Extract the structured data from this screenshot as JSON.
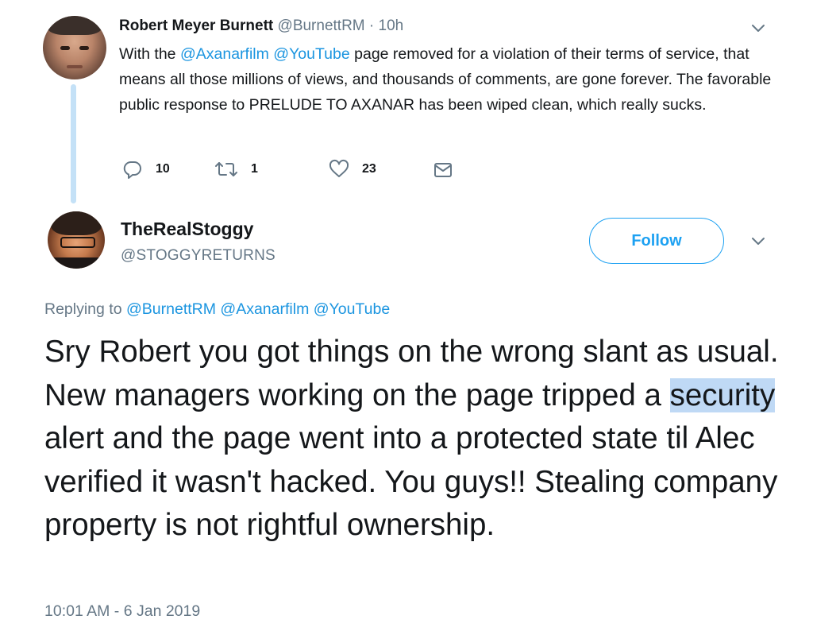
{
  "parent_tweet": {
    "author_name": "Robert Meyer Burnett",
    "author_handle": "@BurnettRM",
    "separator": "·",
    "time": "10h",
    "text_part1": "With the ",
    "mention1": "@Axanarfilm",
    "text_part2": " ",
    "mention2": "@YouTube",
    "text_part3": " page removed for a violation of their terms of service, that means all those millions of views, and thousands of comments, are gone forever. The favorable public response to PRELUDE TO AXANAR has been wiped clean, which really sucks.",
    "reply_count": "10",
    "retweet_count": "1",
    "like_count": "23"
  },
  "reply_tweet": {
    "author_name": "TheRealStoggy",
    "author_handle": "@STOGGYRETURNS",
    "follow_label": "Follow",
    "replying_prefix": "Replying to ",
    "replying_to": [
      "@BurnettRM",
      "@Axanarfilm",
      "@YouTube"
    ],
    "text_before": "Sry Robert you got things on the wrong slant as usual. New managers working on the page tripped a ",
    "text_highlight": "security",
    "text_after": " alert and the page went into a protected state til Alec verified it wasn't hacked.  You guys!! Stealing company property is not rightful ownership.",
    "timestamp": "10:01 AM - 6 Jan 2019"
  },
  "icons": {
    "reply": "reply-icon",
    "retweet": "retweet-icon",
    "like": "heart-icon",
    "dm": "envelope-icon",
    "menu": "chevron-down-icon"
  },
  "colors": {
    "link": "#1b95e0",
    "secondary_text": "#657786",
    "thread_line": "#c4e1f7",
    "selection_highlight": "#bfd9f5"
  }
}
